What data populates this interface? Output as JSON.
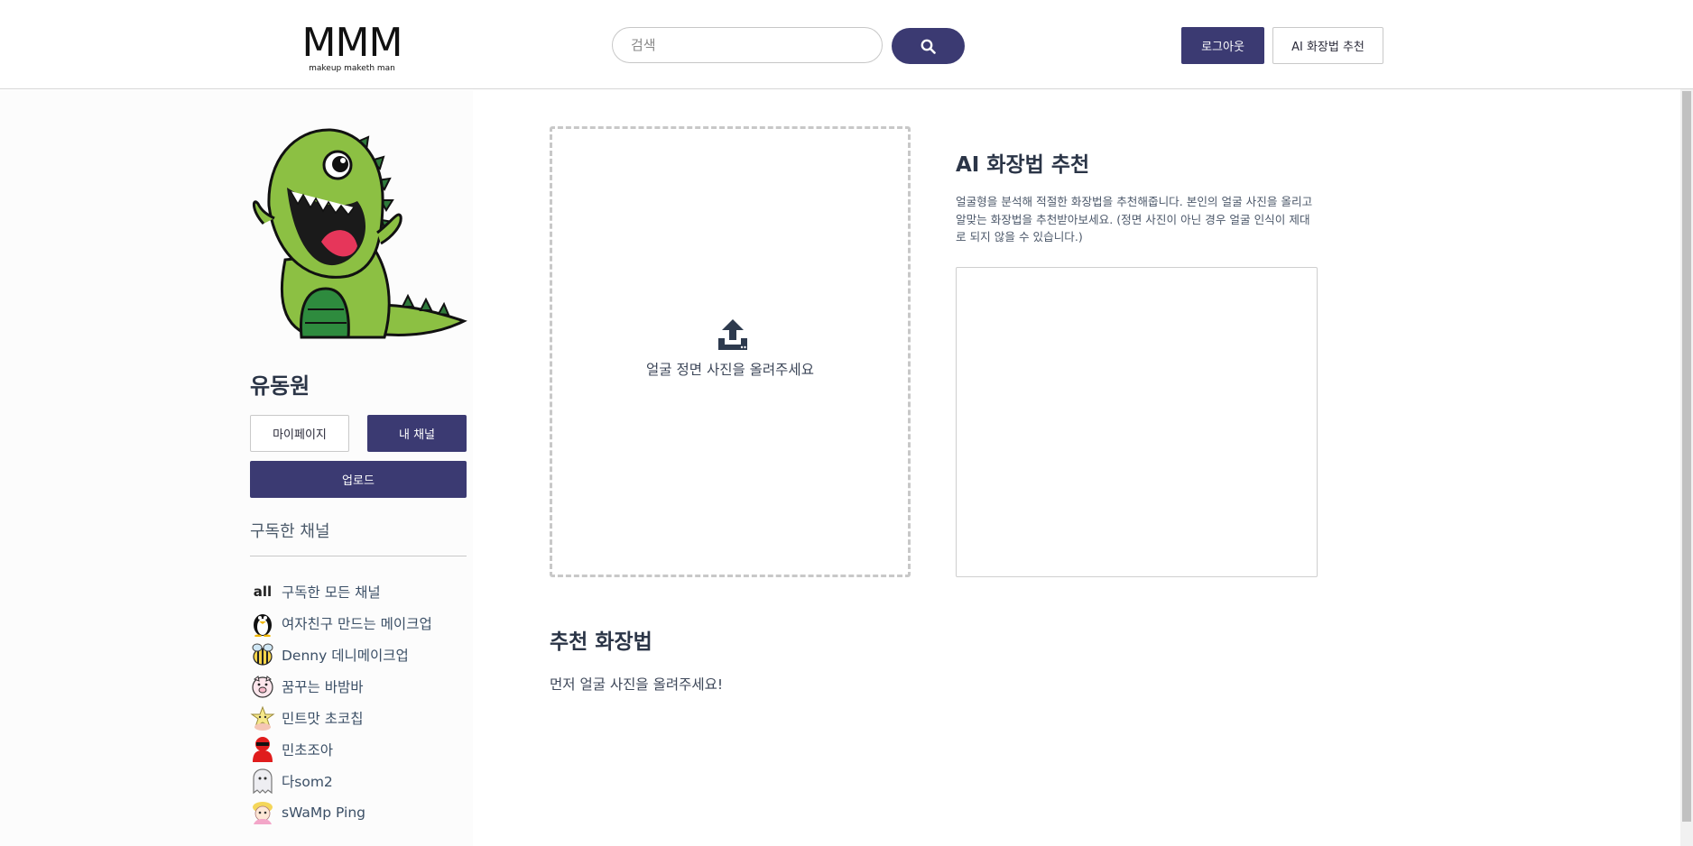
{
  "header": {
    "logo_text": "MMM",
    "logo_tagline": "makeup maketh man",
    "search_placeholder": "검색",
    "logout_label": "로그아웃",
    "ai_label": "AI 화장법 추천",
    "accent_color": "#3b3a72"
  },
  "sidebar": {
    "user_name": "유동원",
    "mypage_label": "마이페이지",
    "mychannel_label": "내 채널",
    "upload_label": "업로드",
    "subscribed_title": "구독한 채널",
    "channels": [
      {
        "icon": "all",
        "label": "구독한 모든 채널"
      },
      {
        "icon": "penguin-avatar",
        "label": "여자친구 만드는 메이크업"
      },
      {
        "icon": "bee-avatar",
        "label": "Denny 데니메이크업"
      },
      {
        "icon": "pig-avatar",
        "label": "꿈꾸는 바밤바"
      },
      {
        "icon": "star-avatar",
        "label": "민트맛 초코칩"
      },
      {
        "icon": "red-figure-avatar",
        "label": "민초조아"
      },
      {
        "icon": "ghost-avatar",
        "label": "다som2"
      },
      {
        "icon": "girl-avatar",
        "label": "sWaMp Ping"
      }
    ]
  },
  "main": {
    "upload_prompt": "얼굴 정면 사진을 올려주세요",
    "ai_title": "AI 화장법 추천",
    "ai_description": "얼굴형을 분석해 적절한 화장법을 추천해줍니다. 본인의 얼굴 사진을 올리고 알맞는 화장법을 추천받아보세요. (정면 사진이 아닌 경우 얼굴 인식이 제대로 되지 않을 수 있습니다.)",
    "recommend_title": "추천 화장법",
    "recommend_text": "먼저 얼굴 사진을 올려주세요!"
  }
}
